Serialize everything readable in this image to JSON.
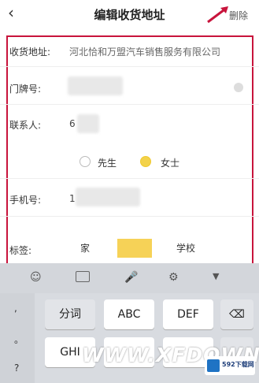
{
  "header": {
    "back_icon": "chevron-left-icon",
    "title": "编辑收货地址",
    "delete_label": "删除"
  },
  "form": {
    "address_label": "收货地址:",
    "address_value": "河北恰和万盟汽车销售服务有限公司",
    "house_label": "门牌号:",
    "contact_label": "联系人:",
    "contact_value_partial": "6",
    "gender_options": [
      "先生",
      "女士"
    ],
    "gender_selected": "女士",
    "phone_label": "手机号:",
    "phone_value_partial": "1",
    "tag_label": "标签:",
    "tags": [
      "家",
      "",
      "学校"
    ],
    "tag_selected_index": 1
  },
  "keyboard": {
    "toolbar_icons": [
      "emoji-icon",
      "keyboard-icon",
      "mic-icon",
      "settings-icon",
      "collapse-icon"
    ],
    "symbols": [
      ",",
      "。",
      "?"
    ],
    "row1": [
      "分词",
      "ABC",
      "DEF"
    ],
    "row2": [
      "GHI"
    ],
    "backspace_icon": "backspace-icon"
  },
  "watermark": {
    "text": "WWW.XFDOWN",
    "logo_text": "592下载网"
  },
  "accent_color": "#c8143c",
  "selected_color": "#f6d257"
}
